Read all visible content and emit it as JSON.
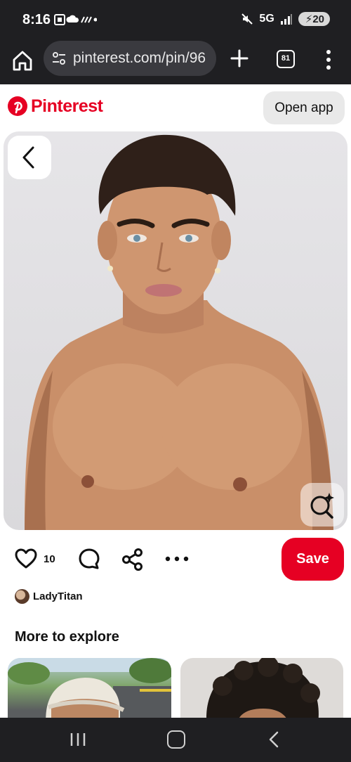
{
  "status_bar": {
    "time": "8:16",
    "network": "5G",
    "battery": "20"
  },
  "browser": {
    "url": "pinterest.com/pin/96",
    "tab_count": "81"
  },
  "header": {
    "brand": "Pinterest",
    "open_app_label": "Open app",
    "brand_color": "#e60023"
  },
  "pin": {
    "like_count": "10",
    "save_label": "Save",
    "author": "LadyTitan"
  },
  "explore": {
    "heading": "More to explore"
  },
  "icons": [
    "home-icon",
    "tune-icon",
    "plus-icon",
    "tabs-icon",
    "more-vert-icon",
    "back-icon",
    "visual-search-icon",
    "heart-icon",
    "comment-icon",
    "share-icon",
    "more-horiz-icon",
    "recents-icon",
    "nav-home-icon",
    "nav-back-icon"
  ]
}
